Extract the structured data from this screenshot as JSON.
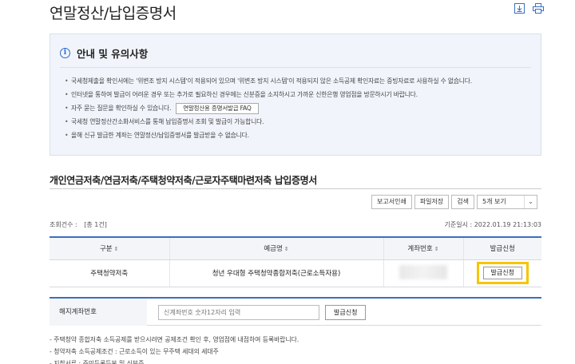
{
  "page": {
    "title": "연말정산/납입증명서"
  },
  "notice": {
    "title": "안내 및 유의사항",
    "items": [
      "국세청제출을 확인서에는 '위변조 방지 시스템'이 적용되어 있으며 '위변조 방지 시스템'이 적용되지 않은 소득공제 확인자료는 증빙자료로 사용하실 수 없습니다.",
      "인터넷을 통하여 발급이 어려운 경우 또는 추가로 필요하신 경우에는 신분증을 소지하시고 가까운 신한은행 영업점을 방문하시기 바랍니다.",
      "자주 묻는 질문을 확인하실 수 있습니다.",
      "국세청 연말정산간소화서비스를 통해 납입증명서 조회 및 발급이 가능합니다.",
      "올해 신규 발급한 계좌는 연말정산/납입증명서를 발급받을 수 없습니다."
    ],
    "faq_button": "연말정산용 증명서발급 FAQ"
  },
  "section": {
    "title": "개인연금저축/연금저축/주택청약저축/근로자주택마련저축 납입증명서"
  },
  "toolbar": {
    "print": "보고서인쇄",
    "save": "파일저장",
    "search": "검색",
    "view_select": "5개 보기"
  },
  "summary": {
    "count_label": "조회건수 :",
    "count_value": "[총 1건]",
    "base_date": "기준일시 : 2022.01.19 21:13:03"
  },
  "table": {
    "headers": [
      "구분",
      "예금명",
      "계좌번호",
      "발급신청"
    ],
    "rows": [
      {
        "type": "주택청약저축",
        "name": "청년 우대형 주택청약종합저축(근로소득자용)",
        "apply": "발급신청"
      }
    ]
  },
  "cancel": {
    "label": "해지계좌번호",
    "placeholder": "신계좌번호 숫자12자리 입력",
    "button": "발급신청"
  },
  "footnotes": [
    "- 주택청약 종합저축 소득공제를 받으시려면 공제조건 확인 후, 영업점에 내점하여 등록바랍니다.",
    "- 청약저축 소득공제조건 : 근로소득이 있는 무주택 세대의 세대주",
    "- 지참서류 : 주민등록등본 및 신분증"
  ],
  "colors": {
    "accent": "#3b6fc0",
    "highlight": "#f5c500"
  }
}
